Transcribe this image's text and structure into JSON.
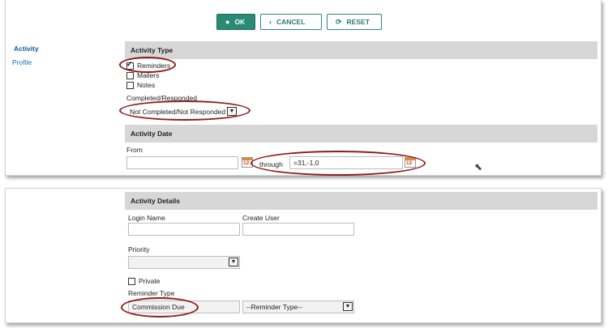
{
  "toolbar": {
    "ok": "OK",
    "cancel": "CANCEL",
    "reset": "RESET"
  },
  "nav": {
    "activity": "Activity",
    "profile": "Profile"
  },
  "activity_type": {
    "header": "Activity Type",
    "options": [
      {
        "label": "Reminders",
        "checked": true
      },
      {
        "label": "Mailers",
        "checked": false
      },
      {
        "label": "Notes",
        "checked": false
      }
    ],
    "status_label": "Completed/Responded",
    "status_value": "Not Completed/Not Responded"
  },
  "activity_date": {
    "header": "Activity Date",
    "from_label": "From",
    "from_value": "",
    "through_label": "through",
    "through_value": "=31,-1,0",
    "calendar_text": "12"
  },
  "activity_details": {
    "header": "Activity Details",
    "login_label": "Login Name",
    "create_user_label": "Create User",
    "priority_label": "Priority",
    "private_label": "Private",
    "reminder_type_label": "Reminder Type",
    "reminder_type_value": "Commission Due",
    "reminder_type_select": "--Reminder Type--"
  }
}
